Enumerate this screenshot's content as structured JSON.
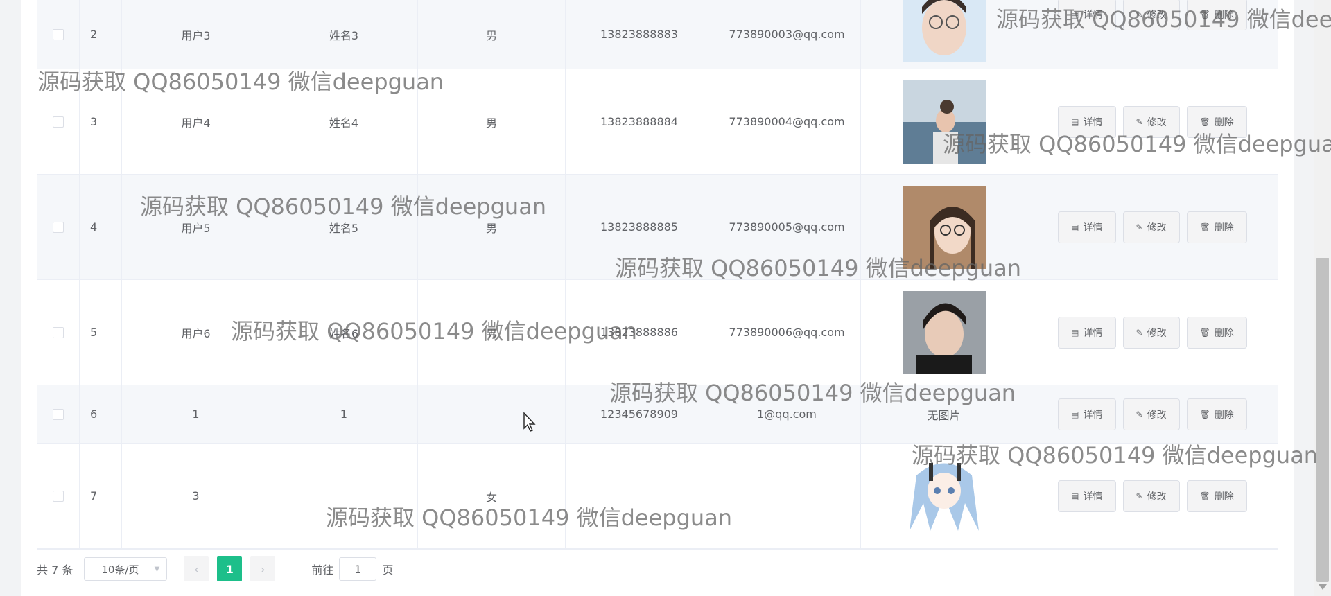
{
  "rows": [
    {
      "index": "2",
      "username": "用户3",
      "realname": "姓名3",
      "sex": "男",
      "phone": "13823888883",
      "email": "773890003@qq.com",
      "photo": "photo-male-glasses"
    },
    {
      "index": "3",
      "username": "用户4",
      "realname": "姓名4",
      "sex": "男",
      "phone": "13823888884",
      "email": "773890004@qq.com",
      "photo": "photo-female-sea"
    },
    {
      "index": "4",
      "username": "用户5",
      "realname": "姓名5",
      "sex": "男",
      "phone": "13823888885",
      "email": "773890005@qq.com",
      "photo": "photo-female-glasses"
    },
    {
      "index": "5",
      "username": "用户6",
      "realname": "姓名6",
      "sex": "男",
      "phone": "13823888886",
      "email": "773890006@qq.com",
      "photo": "photo-male-dark"
    },
    {
      "index": "6",
      "username": "1",
      "realname": "1",
      "sex": "",
      "phone": "12345678909",
      "email": "1@qq.com",
      "photo_text": "无图片"
    },
    {
      "index": "7",
      "username": "3",
      "realname": "",
      "sex": "女",
      "phone": "",
      "email": "",
      "photo": "photo-anime"
    }
  ],
  "actions": {
    "detail": "详情",
    "edit": "修改",
    "delete": "删除"
  },
  "pagination": {
    "total": "共 7 条",
    "page_size": "10条/页",
    "current_page": "1",
    "jump_prefix": "前往",
    "jump_value": "1",
    "jump_suffix": "页"
  },
  "watermark": "源码获取 QQ86050149 微信deepguan",
  "colors": {
    "accent": "#1dbf8a",
    "stripe": "#f5f7fa",
    "border": "#ebeef5"
  }
}
